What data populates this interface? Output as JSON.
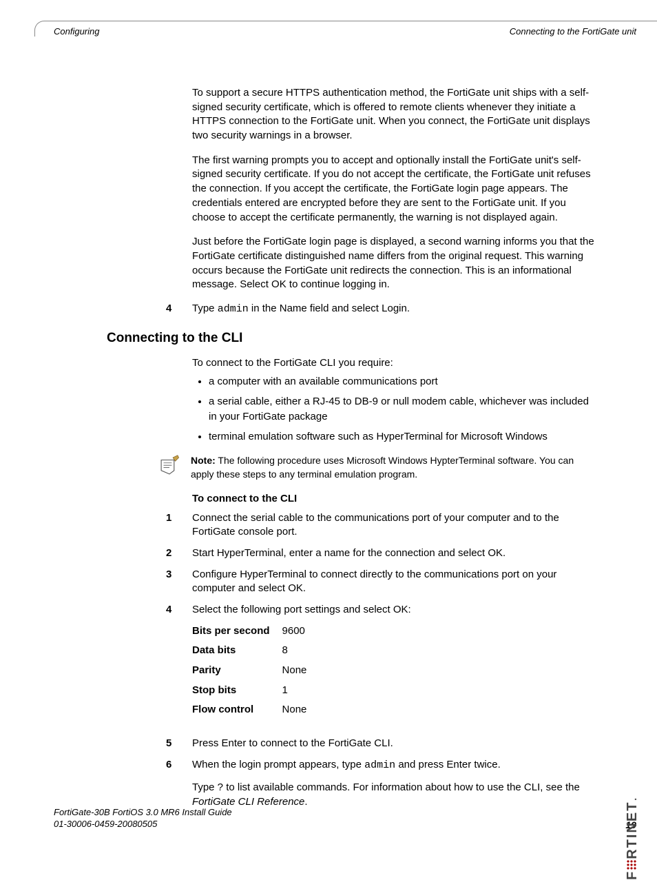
{
  "header": {
    "left": "Configuring",
    "right": "Connecting to the FortiGate unit"
  },
  "body": {
    "para1": "To support a secure HTTPS authentication method, the FortiGate unit ships with a self-signed security certificate, which is offered to remote clients whenever they initiate a HTTPS connection to the FortiGate unit. When you connect, the FortiGate unit displays two security warnings in a browser.",
    "para2": "The first warning prompts you to accept and optionally install the FortiGate unit's self-signed security certificate. If you do not accept the certificate, the FortiGate unit refuses the connection. If you accept the certificate, the FortiGate login page appears. The credentials entered are encrypted before they are sent to the FortiGate unit. If you choose to accept the certificate permanently, the warning is not displayed again.",
    "para3": "Just before the FortiGate login page is displayed, a second warning informs you that the FortiGate certificate distinguished name differs from the original request. This warning occurs because the FortiGate unit redirects the connection. This is an informational message. Select OK to continue logging in.",
    "step4_num": "4",
    "step4_a": "Type ",
    "step4_mono": "admin",
    "step4_b": " in the Name field and select Login.",
    "h2": "Connecting to the CLI",
    "intro_cli": "To connect to the FortiGate CLI you require:",
    "req": {
      "r1": "a computer with an available communications port",
      "r2": "a serial cable, either a RJ-45 to DB-9 or null modem cable, whichever was included in your FortiGate package",
      "r3": "terminal emulation software such as HyperTerminal for Microsoft Windows"
    },
    "note_label": "Note:",
    "note_body": " The following procedure uses Microsoft Windows HypterTerminal software. You can apply these steps to any terminal emulation program.",
    "sub": "To connect to the CLI",
    "steps": {
      "n1": "1",
      "s1": "Connect the serial cable to the communications port of your computer and to the FortiGate console port.",
      "n2": "2",
      "s2": "Start HyperTerminal, enter a name for the connection and select OK.",
      "n3": "3",
      "s3": "Configure HyperTerminal to connect directly to the communications port on your computer and select OK.",
      "n4": "4",
      "s4": "Select the following port settings and select OK:",
      "n5": "5",
      "s5": "Press Enter to connect to the FortiGate CLI.",
      "n6": "6",
      "s6a": "When the login prompt appears, type ",
      "s6mono": "admin",
      "s6b": " and press Enter twice.",
      "s6_follow_a": "Type ? to list available commands. For information about how to use the CLI, see the ",
      "s6_follow_i": "FortiGate CLI Reference",
      "s6_follow_b": "."
    },
    "settings": {
      "k1": "Bits per second",
      "v1": "9600",
      "k2": "Data bits",
      "v2": "8",
      "k3": "Parity",
      "v3": "None",
      "k4": "Stop bits",
      "v4": "1",
      "k5": "Flow control",
      "v5": "None"
    }
  },
  "footer": {
    "line1": "FortiGate-30B FortiOS 3.0 MR6 Install Guide",
    "line2": "01-30006-0459-20080505",
    "page": "19"
  },
  "logo": {
    "pre": "F",
    "post": "RTINET"
  }
}
